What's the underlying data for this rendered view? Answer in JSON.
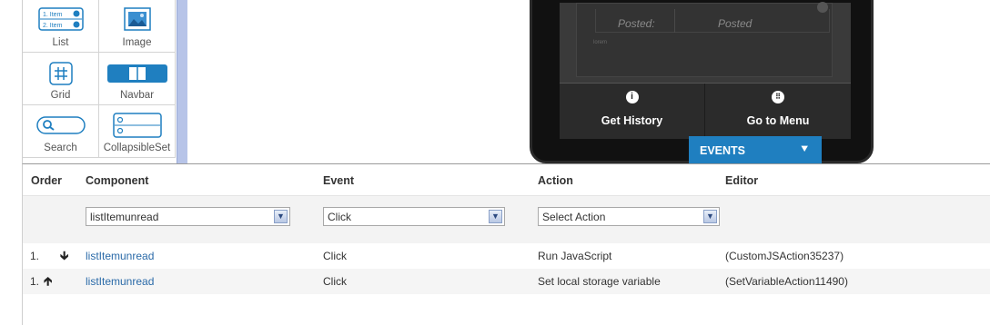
{
  "palette": {
    "items": [
      {
        "label": "List",
        "icon": "list-icon"
      },
      {
        "label": "Image",
        "icon": "image-icon"
      },
      {
        "label": "Grid",
        "icon": "grid-icon"
      },
      {
        "label": "Navbar",
        "icon": "navbar-icon"
      },
      {
        "label": "Search",
        "icon": "search-icon"
      },
      {
        "label": "CollapsibleSet",
        "icon": "collapsibleset-icon"
      }
    ],
    "list_icon_lines": [
      "1. Item",
      "2. Item"
    ]
  },
  "preview": {
    "posted_left": "Posted:",
    "posted_right": "Posted",
    "tiny_text": "lorem",
    "buttons": [
      {
        "label": "Get History",
        "icon": "info-icon"
      },
      {
        "label": "Go to Menu",
        "icon": "grid-dots-icon"
      }
    ],
    "events_tab": "EVENTS"
  },
  "events_table": {
    "headers": {
      "order": "Order",
      "component": "Component",
      "event": "Event",
      "action": "Action",
      "editor": "Editor"
    },
    "filters": {
      "component": "listItemunread",
      "event": "Click",
      "action": "Select Action"
    },
    "rows": [
      {
        "order": "1.",
        "direction": "down",
        "component": "listItemunread",
        "event": "Click",
        "action": "Run JavaScript",
        "editor": "(CustomJSAction35237)"
      },
      {
        "order": "1.",
        "direction": "up",
        "component": "listItemunread",
        "event": "Click",
        "action": "Set local storage variable",
        "editor": "(SetVariableAction11490)"
      }
    ]
  },
  "colors": {
    "accent": "#1f7fc0",
    "link": "#2a6aa8",
    "palette_scroll": "#b7c4e8"
  }
}
